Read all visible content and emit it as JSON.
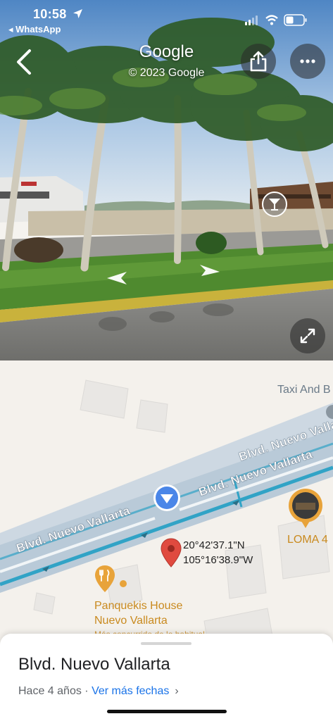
{
  "status_bar": {
    "time": "10:58",
    "back_app": "◂ WhatsApp"
  },
  "street_view": {
    "title": "Google",
    "copyright": "© 2023 Google",
    "place_marker_icon": "cocktail-icon"
  },
  "map": {
    "road_name_1": "Blvd. Nuevo Vallarta",
    "road_name_2": "Blvd. Nuevo Vallarta",
    "road_name_3": "Blvd. Nuevo Vallarta",
    "poi_taxi": "Taxi And B",
    "restaurant_name_line1": "Panquekis House",
    "restaurant_name_line2": "Nuevo Vallarta",
    "restaurant_subtitle": "Más concurrido de lo habitual",
    "loma_label": "LOMA 4",
    "coordinates_lat": "20°42'37.1\"N",
    "coordinates_lng": "105°16'38.9\"W",
    "colors": {
      "road": "#b9cad8",
      "route_line": "#31a3c6",
      "pin": "#e04a3f",
      "viewpoint": "#4a86e8",
      "food": "#e8a33a"
    }
  },
  "sheet": {
    "title": "Blvd. Nuevo Vallarta",
    "age": "Hace 4 años · ",
    "more_dates": "Ver más fechas",
    "chevron": "›"
  }
}
